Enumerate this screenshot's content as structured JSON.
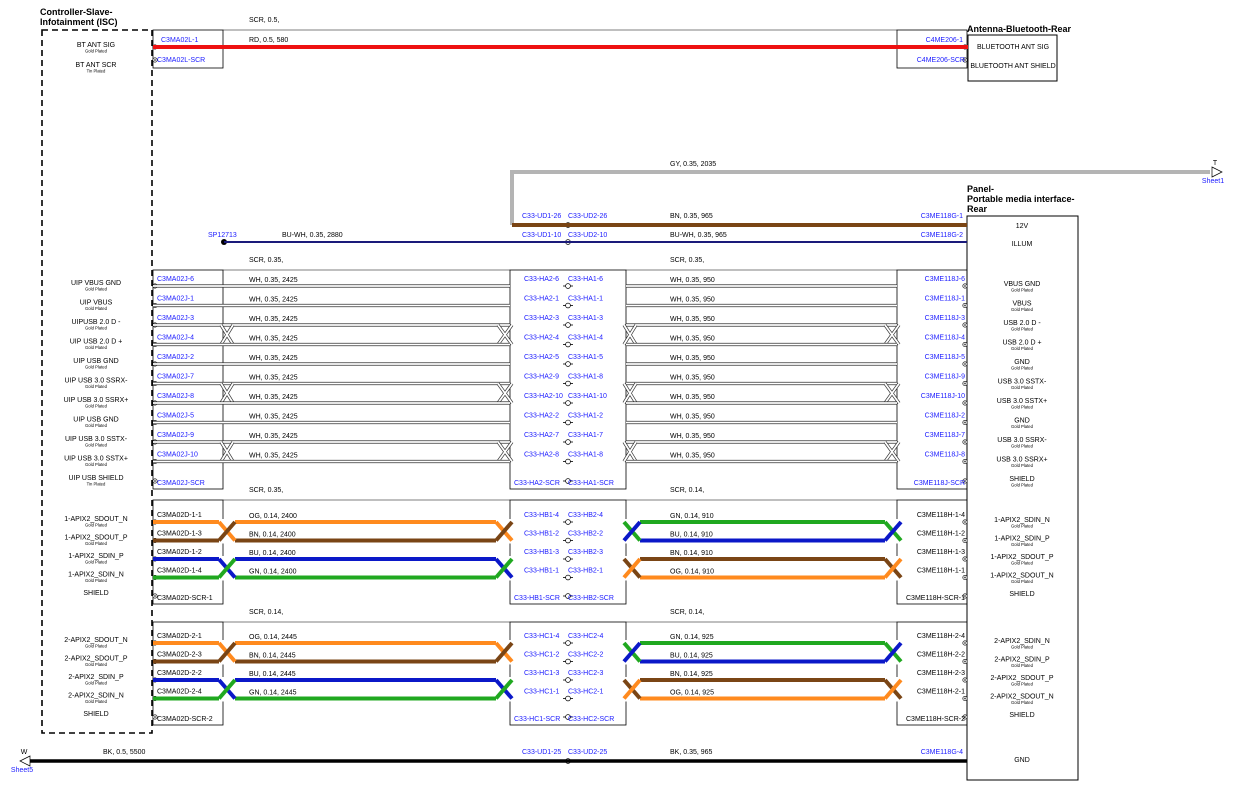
{
  "components": {
    "isc": {
      "title_lines": [
        "Controller-Slave-",
        "Infotainment (ISC)"
      ]
    },
    "antenna": {
      "title": "Antenna-Bluetooth-Rear"
    },
    "panel": {
      "title_lines": [
        "Panel-",
        "Portable media interface-",
        "Rear"
      ]
    }
  },
  "colors": {
    "RD": "#ee1111",
    "GY": "#b4b4b4",
    "BN": "#7a4515",
    "BU": "#0b18c8",
    "GN": "#20a820",
    "OG": "#ff8a1e",
    "WH": "#ffffff",
    "BK": "#000000",
    "conductor": "#1a1aff"
  },
  "bt": {
    "group_label": "SCR, 0.5,",
    "wire_label": "RD, 0.5, 580",
    "left_pins": [
      {
        "name": "BT ANT SIG",
        "plating": "Gold Plated",
        "connector": "C3MA02L-1"
      },
      {
        "name": "BT ANT SCR",
        "plating": "Tin Plated",
        "connector": "C3MA02L-SCR"
      }
    ],
    "right_pins": [
      {
        "name": "BLUETOOTH ANT SIG",
        "connector": "C4ME206-1"
      },
      {
        "name": "BLUETOOTH ANT SHIELD",
        "connector": "C4ME206-SCR"
      }
    ]
  },
  "gy_wire": {
    "label": "GY, 0.35, 2035",
    "offsheet": "T",
    "sheet": "Sheet1"
  },
  "twelve_v": {
    "left_conn": "C33-UD1-26",
    "mid_conn": "C33-UD2-26",
    "label": "BN, 0.35, 965",
    "right_conn": "C3ME118G-1",
    "pin": "12V"
  },
  "illum": {
    "splice": "SP12713",
    "left_label": "BU-WH, 0.35, 2880",
    "left_conn": "C33-UD1-10",
    "mid_conn": "C33-UD2-10",
    "right_label": "BU-WH, 0.35, 965",
    "right_conn": "C3ME118G-2",
    "pin": "ILLUM"
  },
  "usb": {
    "left_group": "SCR, 0.35,",
    "right_group": "SCR, 0.35,",
    "rows": [
      {
        "lpin": "UIP VBUS GND",
        "lplate": "Gold Plated",
        "lconn": "C3MA02J-6",
        "llabel": "WH, 0.35, 2425",
        "ma": "C33-HA2-6",
        "mb": "C33-HA1-6",
        "rlabel": "WH, 0.35, 950",
        "rconn": "C3ME118J-6",
        "rpin": "VBUS GND",
        "rplate": "Gold Plated"
      },
      {
        "lpin": "UIP VBUS",
        "lplate": "Gold Plated",
        "lconn": "C3MA02J-1",
        "llabel": "WH, 0.35, 2425",
        "ma": "C33-HA2-1",
        "mb": "C33-HA1-1",
        "rlabel": "WH, 0.35, 950",
        "rconn": "C3ME118J-1",
        "rpin": "VBUS",
        "rplate": "Gold Plated"
      },
      {
        "lpin": "UIPUSB 2.0 D -",
        "lplate": "Gold Plated",
        "lconn": "C3MA02J-3",
        "llabel": "WH, 0.35, 2425",
        "ma": "C33-HA2-3",
        "mb": "C33-HA1-3",
        "rlabel": "WH, 0.35, 950",
        "rconn": "C3ME118J-3",
        "rpin": "USB 2.0 D -",
        "rplate": "Gold Plated"
      },
      {
        "lpin": "UIP USB 2.0 D +",
        "lplate": "Gold Plated",
        "lconn": "C3MA02J-4",
        "llabel": "WH, 0.35, 2425",
        "ma": "C33-HA2-4",
        "mb": "C33-HA1-4",
        "rlabel": "WH, 0.35, 950",
        "rconn": "C3ME118J-4",
        "rpin": "USB 2.0 D +",
        "rplate": "Gold Plated"
      },
      {
        "lpin": "UIP USB GND",
        "lplate": "Gold Plated",
        "lconn": "C3MA02J-2",
        "llabel": "WH, 0.35, 2425",
        "ma": "C33-HA2-5",
        "mb": "C33-HA1-5",
        "rlabel": "WH, 0.35, 950",
        "rconn": "C3ME118J-5",
        "rpin": "GND",
        "rplate": "Gold Plated"
      },
      {
        "lpin": "UIP USB 3.0 SSRX-",
        "lplate": "Gold Plated",
        "lconn": "C3MA02J-7",
        "llabel": "WH, 0.35, 2425",
        "ma": "C33-HA2-9",
        "mb": "C33-HA1-8",
        "rlabel": "WH, 0.35, 950",
        "rconn": "C3ME118J-9",
        "rpin": "USB 3.0 SSTX-",
        "rplate": "Gold Plated"
      },
      {
        "lpin": "UIP USB 3.0 SSRX+",
        "lplate": "Gold Plated",
        "lconn": "C3MA02J-8",
        "llabel": "WH, 0.35, 2425",
        "ma": "C33-HA2-10",
        "mb": "C33-HA1-10",
        "rlabel": "WH, 0.35, 950",
        "rconn": "C3ME118J-10",
        "rpin": "USB 3.0 SSTX+",
        "rplate": "Gold Plated"
      },
      {
        "lpin": "UIP USB GND",
        "lplate": "Gold Plated",
        "lconn": "C3MA02J-5",
        "llabel": "WH, 0.35, 2425",
        "ma": "C33-HA2-2",
        "mb": "C33-HA1-2",
        "rlabel": "WH, 0.35, 950",
        "rconn": "C3ME118J-2",
        "rpin": "GND",
        "rplate": "Gold Plated"
      },
      {
        "lpin": "UIP USB 3.0 SSTX-",
        "lplate": "Gold Plated",
        "lconn": "C3MA02J-9",
        "llabel": "WH, 0.35, 2425",
        "ma": "C33-HA2-7",
        "mb": "C33-HA1-7",
        "rlabel": "WH, 0.35, 950",
        "rconn": "C3ME118J-7",
        "rpin": "USB 3.0 SSRX-",
        "rplate": "Gold Plated"
      },
      {
        "lpin": "UIP USB 3.0 SSTX+",
        "lplate": "Gold Plated",
        "lconn": "C3MA02J-10",
        "llabel": "WH, 0.35, 2425",
        "ma": "C33-HA2-8",
        "mb": "C33-HA1-8",
        "rlabel": "WH, 0.35, 950",
        "rconn": "C3ME118J-8",
        "rpin": "USB 3.0 SSRX+",
        "rplate": "Gold Plated"
      }
    ],
    "shield": {
      "lpin": "UIP USB SHIELD",
      "lplate": "Tin Plated",
      "lconn": "C3MA02J-SCR",
      "ma": "C33-HA2-SCR",
      "mb": "C33-HA1-SCR",
      "rconn": "C3ME118J-SCR",
      "rpin": "SHIELD",
      "rplate": "Gold Plated"
    }
  },
  "apix1": {
    "left_group": "SCR, 0.35,",
    "right_group": "SCR, 0.14,",
    "rows": [
      {
        "lpin": "1-APIX2_SDOUT_N",
        "lplate": "Gold Plated",
        "lconn": "C3MA02D-1-1",
        "llabel": "OG, 0.14, 2400",
        "ma": "C33-HB1-4",
        "mb": "C33-HB2-4",
        "rlabel": "GN, 0.14, 910",
        "rconn": "C3ME118H-1-4",
        "rpin": "1-APIX2_SDIN_N",
        "rplate": "Gold Plated"
      },
      {
        "lpin": "1-APIX2_SDOUT_P",
        "lplate": "Gold Plated",
        "lconn": "C3MA02D-1-3",
        "llabel": "BN, 0.14, 2400",
        "ma": "C33-HB1-2",
        "mb": "C33-HB2-2",
        "rlabel": "BU, 0.14, 910",
        "rconn": "C3ME118H-1-2",
        "rpin": "1-APIX2_SDIN_P",
        "rplate": "Gold Plated"
      },
      {
        "lpin": "1-APIX2_SDIN_P",
        "lplate": "Gold Plated",
        "lconn": "C3MA02D-1-2",
        "llabel": "BU, 0.14, 2400",
        "ma": "C33-HB1-3",
        "mb": "C33-HB2-3",
        "rlabel": "BN, 0.14, 910",
        "rconn": "C3ME118H-1-3",
        "rpin": "1-APIX2_SDOUT_P",
        "rplate": "Gold Plated"
      },
      {
        "lpin": "1-APIX2_SDIN_N",
        "lplate": "Gold Plated",
        "lconn": "C3MA02D-1-4",
        "llabel": "GN, 0.14, 2400",
        "ma": "C33-HB1-1",
        "mb": "C33-HB2-1",
        "rlabel": "OG, 0.14, 910",
        "rconn": "C3ME118H-1-1",
        "rpin": "1-APIX2_SDOUT_N",
        "rplate": "Gold Plated"
      }
    ],
    "shield": {
      "lpin": "SHIELD",
      "lconn": "C3MA02D-SCR-1",
      "ma": "C33-HB1-SCR",
      "mb": "C33-HB2-SCR",
      "rconn": "C3ME118H-SCR-1",
      "rpin": "SHIELD"
    }
  },
  "apix2": {
    "left_group": "SCR, 0.14,",
    "right_group": "SCR, 0.14,",
    "rows": [
      {
        "lpin": "2-APIX2_SDOUT_N",
        "lplate": "Gold Plated",
        "lconn": "C3MA02D-2-1",
        "llabel": "OG, 0.14, 2445",
        "ma": "C33-HC1-4",
        "mb": "C33-HC2-4",
        "rlabel": "GN, 0.14, 925",
        "rconn": "C3ME118H-2-4",
        "rpin": "2-APIX2_SDIN_N",
        "rplate": "Gold Plated"
      },
      {
        "lpin": "2-APIX2_SDOUT_P",
        "lplate": "Gold Plated",
        "lconn": "C3MA02D-2-3",
        "llabel": "BN, 0.14, 2445",
        "ma": "C33-HC1-2",
        "mb": "C33-HC2-2",
        "rlabel": "BU, 0.14, 925",
        "rconn": "C3ME118H-2-2",
        "rpin": "2-APIX2_SDIN_P",
        "rplate": "Gold Plated"
      },
      {
        "lpin": "2-APIX2_SDIN_P",
        "lplate": "Gold Plated",
        "lconn": "C3MA02D-2-2",
        "llabel": "BU, 0.14, 2445",
        "ma": "C33-HC1-3",
        "mb": "C33-HC2-3",
        "rlabel": "BN, 0.14, 925",
        "rconn": "C3ME118H-2-3",
        "rpin": "2-APIX2_SDOUT_P",
        "rplate": "Gold Plated"
      },
      {
        "lpin": "2-APIX2_SDIN_N",
        "lplate": "Gold Plated",
        "lconn": "C3MA02D-2-4",
        "llabel": "GN, 0.14, 2445",
        "ma": "C33-HC1-1",
        "mb": "C33-HC2-1",
        "rlabel": "OG, 0.14, 925",
        "rconn": "C3ME118H-2-1",
        "rpin": "2-APIX2_SDOUT_N",
        "rplate": "Gold Plated"
      }
    ],
    "shield": {
      "lpin": "SHIELD",
      "lconn": "C3MA02D-SCR-2",
      "ma": "C33-HC1-SCR",
      "mb": "C33-HC2-SCR",
      "rconn": "C3ME118H-SCR-2",
      "rpin": "SHIELD"
    }
  },
  "gnd": {
    "offsheet": "W",
    "sheet": "Sheet5",
    "left_label": "BK, 0.5, 5500",
    "left_conn": "C33-UD1-25",
    "mid_conn": "C33-UD2-25",
    "right_label": "BK, 0.35, 965",
    "right_conn": "C3ME118G-4",
    "pin": "GND"
  }
}
